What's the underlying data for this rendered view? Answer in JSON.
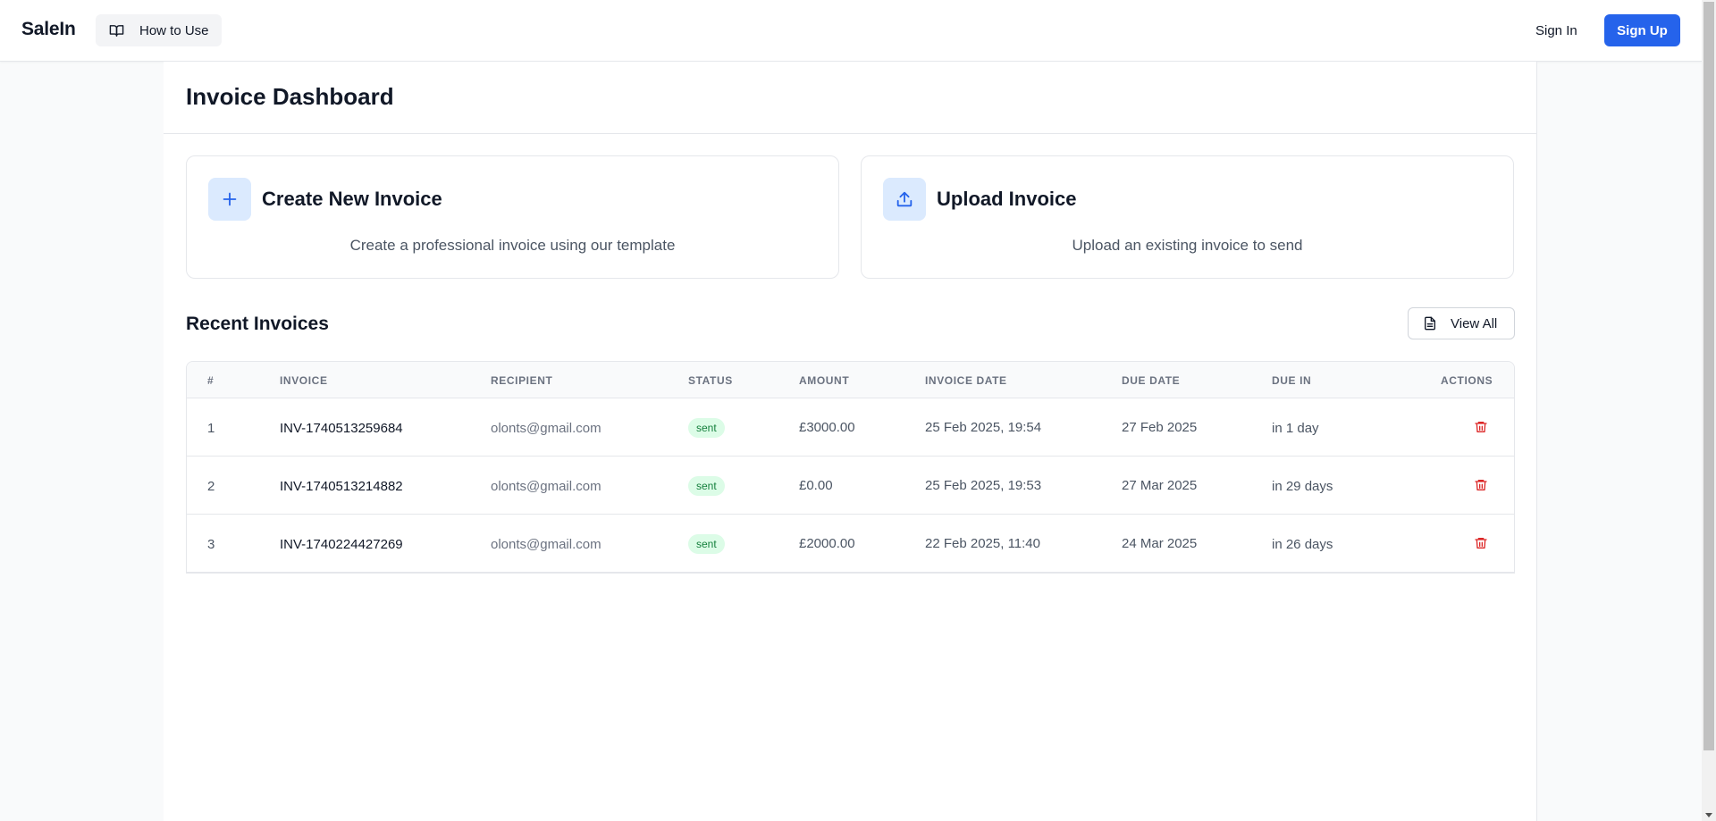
{
  "header": {
    "brand": "SaleIn",
    "how_to_use": "How to Use",
    "sign_in": "Sign In",
    "sign_up": "Sign Up"
  },
  "page": {
    "title": "Invoice Dashboard"
  },
  "cards": [
    {
      "title": "Create New Invoice",
      "description": "Create a professional invoice using our template",
      "icon": "plus-icon"
    },
    {
      "title": "Upload Invoice",
      "description": "Upload an existing invoice to send",
      "icon": "upload-icon"
    }
  ],
  "recent": {
    "title": "Recent Invoices",
    "view_all": "View All",
    "columns": [
      "#",
      "Invoice",
      "Recipient",
      "Status",
      "Amount",
      "Invoice Date",
      "Due Date",
      "Due In",
      "Actions"
    ],
    "rows": [
      {
        "num": "1",
        "invoice": "INV-1740513259684",
        "recipient": "olonts@gmail.com",
        "status": "sent",
        "amount": "£3000.00",
        "invoice_date": "25 Feb 2025, 19:54",
        "due_date": "27 Feb 2025",
        "due_in": "in 1 day"
      },
      {
        "num": "2",
        "invoice": "INV-1740513214882",
        "recipient": "olonts@gmail.com",
        "status": "sent",
        "amount": "£0.00",
        "invoice_date": "25 Feb 2025, 19:53",
        "due_date": "27 Mar 2025",
        "due_in": "in 29 days"
      },
      {
        "num": "3",
        "invoice": "INV-1740224427269",
        "recipient": "olonts@gmail.com",
        "status": "sent",
        "amount": "£2000.00",
        "invoice_date": "22 Feb 2025, 11:40",
        "due_date": "24 Mar 2025",
        "due_in": "in 26 days"
      }
    ]
  },
  "colors": {
    "primary": "#2563eb",
    "status_sent_bg": "#dcfce7",
    "status_sent_text": "#15803d",
    "delete": "#dc2626"
  }
}
